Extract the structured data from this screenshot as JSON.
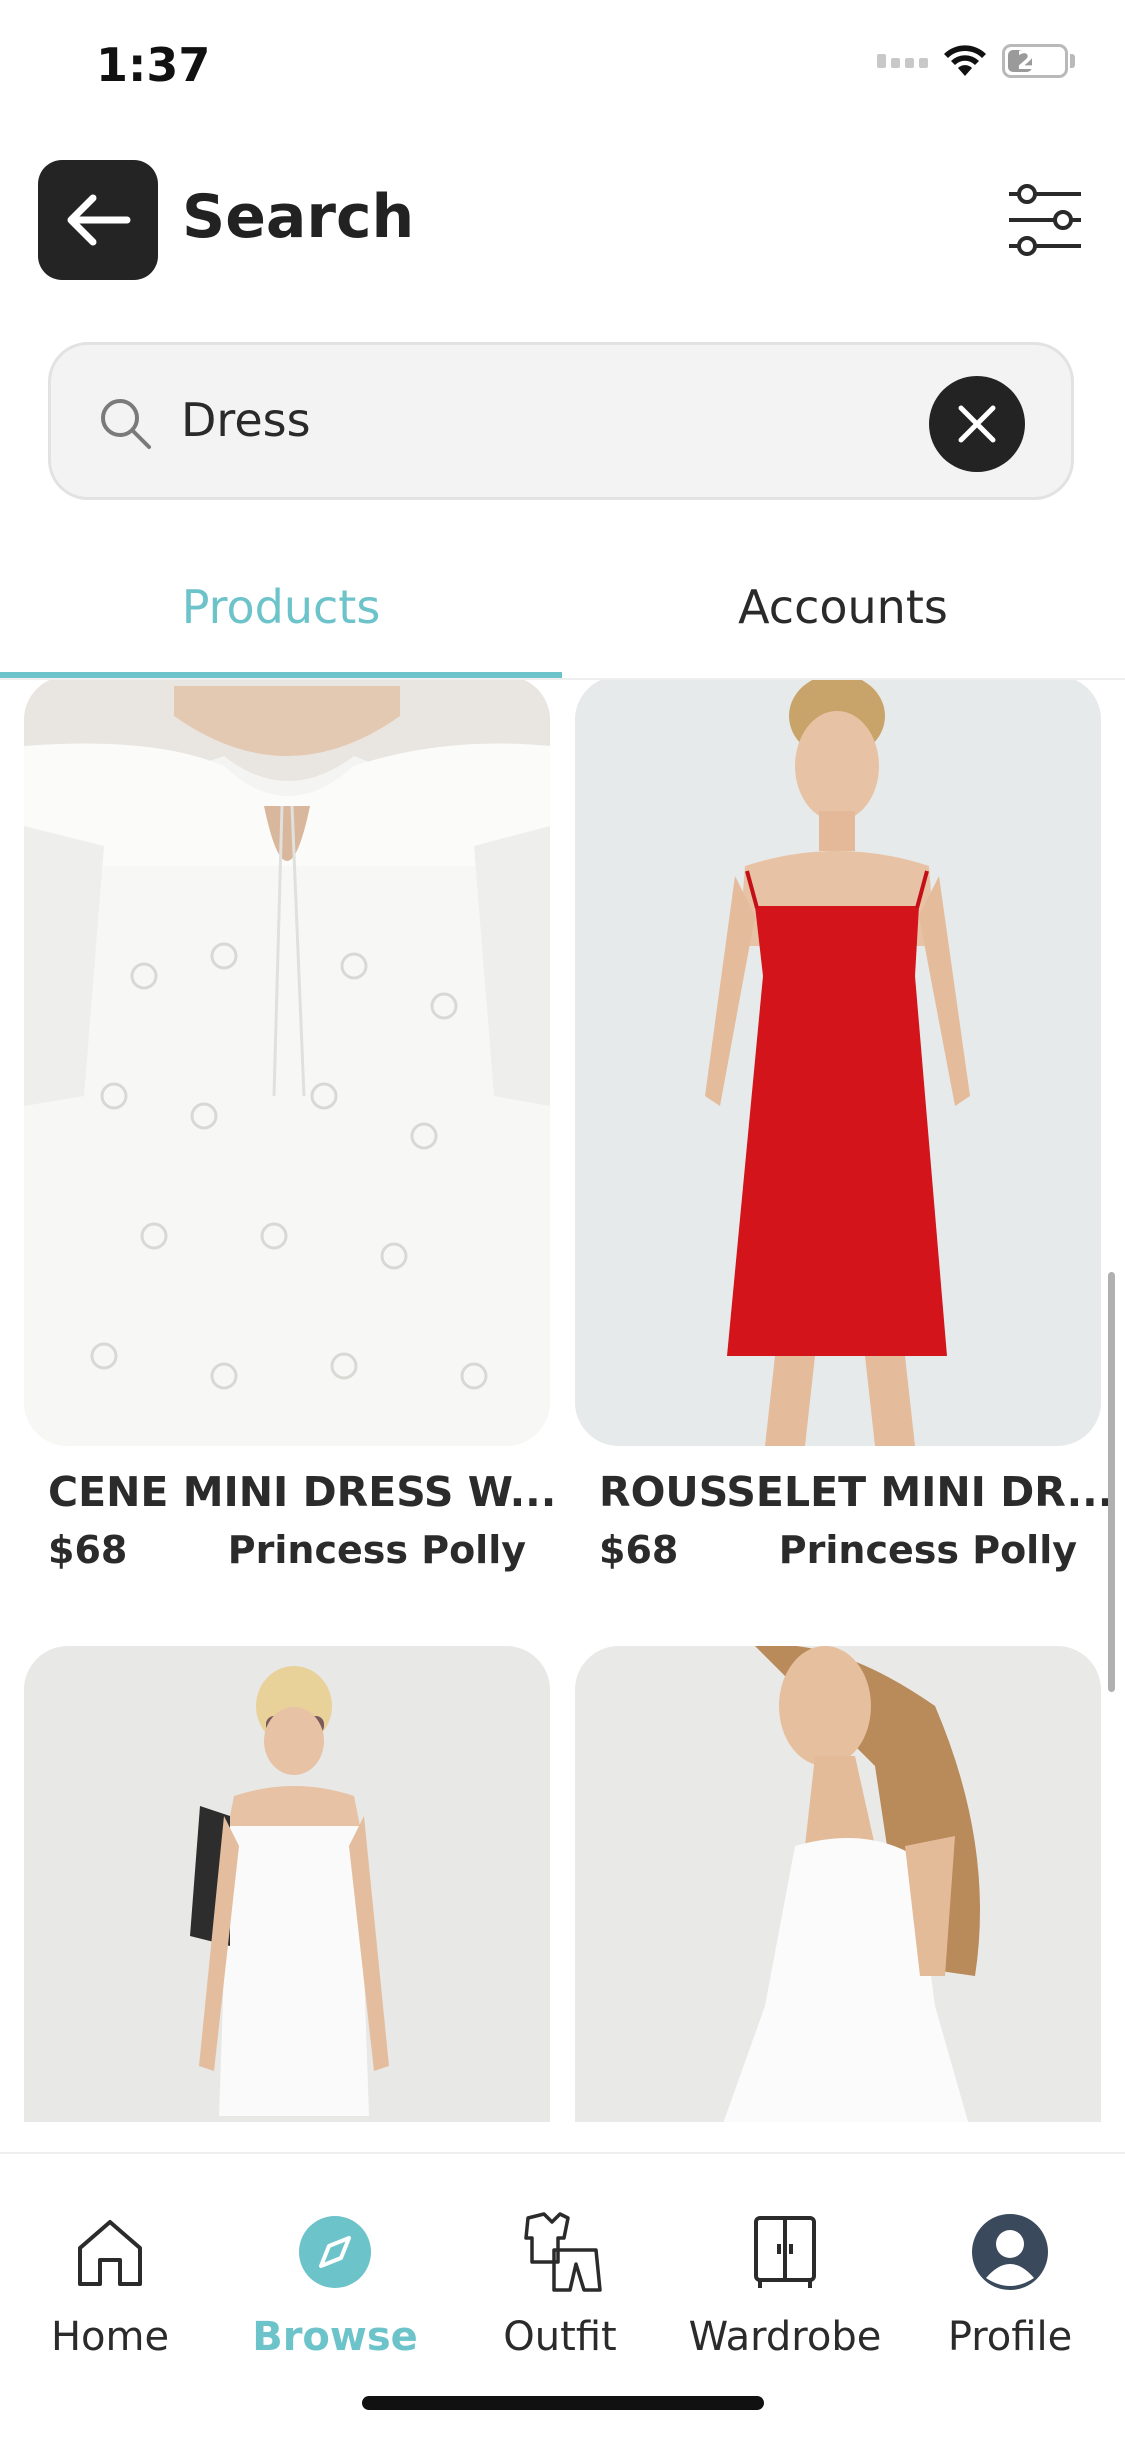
{
  "status_bar": {
    "time": "1:37",
    "battery": "23"
  },
  "header": {
    "title": "Search",
    "back_icon": "arrow-left-icon",
    "filter_icon": "sliders-icon"
  },
  "search": {
    "value": "Dress",
    "clear_icon": "close-icon"
  },
  "tabs": [
    {
      "label": "Products",
      "active": true
    },
    {
      "label": "Accounts",
      "active": false
    }
  ],
  "products": [
    {
      "name": "CENE MINI DRESS W...",
      "price": "$68",
      "brand": "Princess Polly"
    },
    {
      "name": "ROUSSELET MINI DR...",
      "price": "$68",
      "brand": "Princess Polly"
    },
    {
      "name": "",
      "price": "",
      "brand": ""
    },
    {
      "name": "",
      "price": "",
      "brand": ""
    }
  ],
  "bottom_nav": [
    {
      "label": "Home",
      "icon": "home-icon",
      "active": false
    },
    {
      "label": "Browse",
      "icon": "compass-icon",
      "active": true
    },
    {
      "label": "Outfit",
      "icon": "outfit-icon",
      "active": false
    },
    {
      "label": "Wardrobe",
      "icon": "wardrobe-icon",
      "active": false
    },
    {
      "label": "Profile",
      "icon": "profile-icon",
      "active": false
    }
  ],
  "colors": {
    "accent": "#6cc3c9",
    "dark": "#242424",
    "red_dress": "#d4141b"
  }
}
